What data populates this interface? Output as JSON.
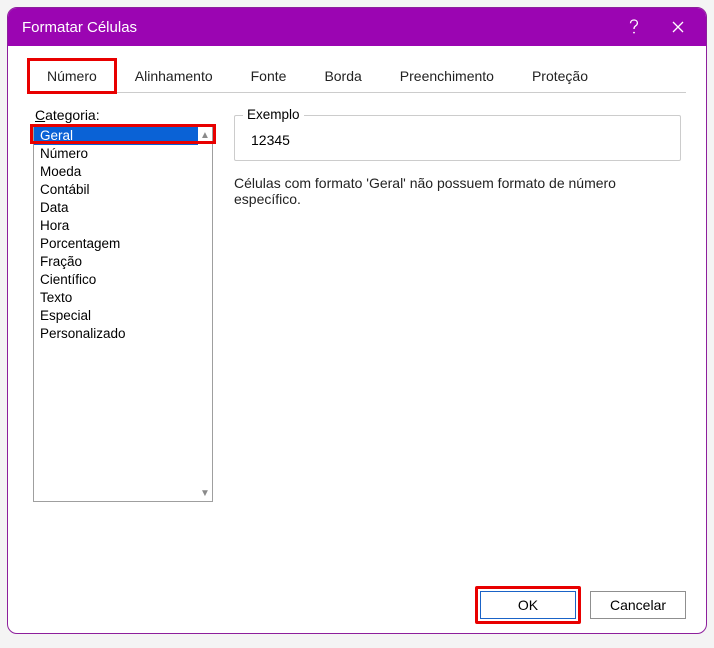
{
  "dialog": {
    "title": "Formatar Células"
  },
  "tabs": [
    {
      "label": "Número",
      "active": true,
      "highlight": true
    },
    {
      "label": "Alinhamento"
    },
    {
      "label": "Fonte"
    },
    {
      "label": "Borda"
    },
    {
      "label": "Preenchimento"
    },
    {
      "label": "Proteção"
    }
  ],
  "category": {
    "underline_char": "C",
    "label_rest": "ategoria:",
    "selected_index": 0,
    "items": [
      "Geral",
      "Número",
      "Moeda",
      "Contábil",
      "Data",
      "Hora",
      "Porcentagem",
      "Fração",
      "Científico",
      "Texto",
      "Especial",
      "Personalizado"
    ]
  },
  "example": {
    "legend": "Exemplo",
    "value": "12345"
  },
  "description": "Células com formato 'Geral' não possuem formato de número específico.",
  "footer": {
    "ok": "OK",
    "cancel": "Cancelar"
  }
}
